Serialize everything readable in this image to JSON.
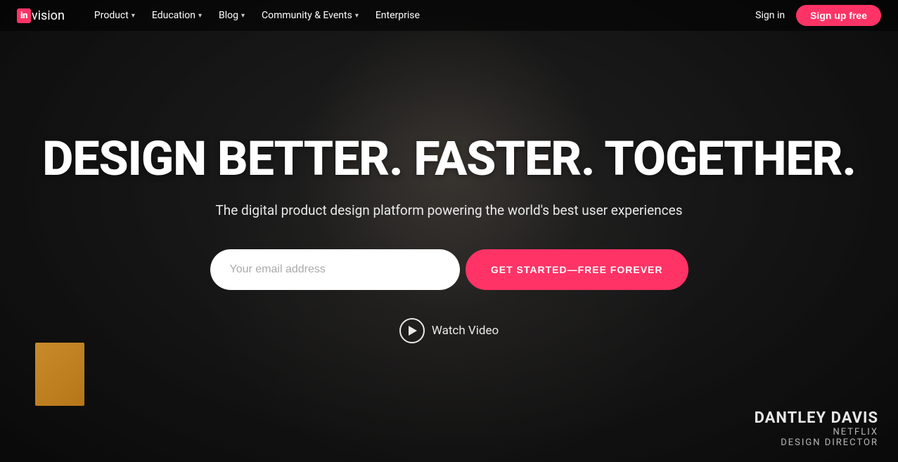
{
  "logo": {
    "box_text": "in",
    "text": "vision"
  },
  "nav": {
    "items": [
      {
        "label": "Product",
        "has_dropdown": true
      },
      {
        "label": "Education",
        "has_dropdown": true
      },
      {
        "label": "Blog",
        "has_dropdown": true
      },
      {
        "label": "Community & Events",
        "has_dropdown": true
      },
      {
        "label": "Enterprise",
        "has_dropdown": false
      }
    ],
    "sign_in": "Sign in",
    "signup": "Sign up free"
  },
  "hero": {
    "title": "DESIGN BETTER. FASTER. TOGETHER.",
    "subtitle": "The digital product design platform powering the world's best user experiences",
    "email_placeholder": "Your email address",
    "cta_button": "GET STARTED—FREE FOREVER",
    "watch_video": "Watch Video"
  },
  "credit": {
    "name": "DANTLEY DAVIS",
    "company": "NETFLIX",
    "role": "DESIGN DIRECTOR"
  }
}
